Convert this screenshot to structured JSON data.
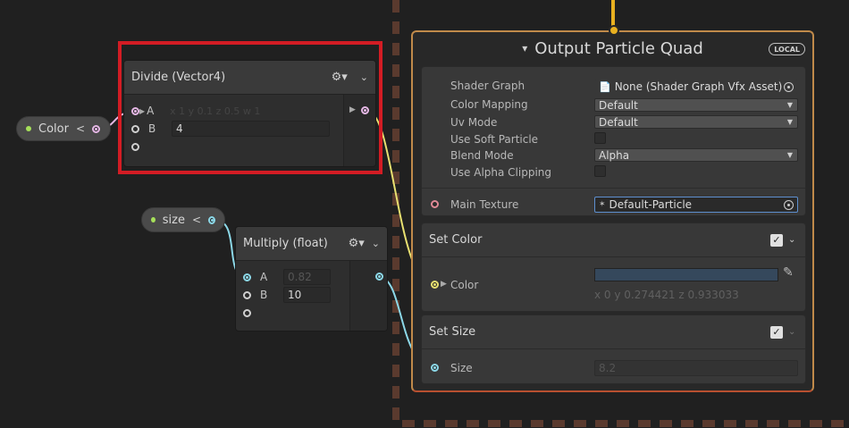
{
  "color_pill": {
    "label": "Color"
  },
  "size_pill": {
    "label": "size"
  },
  "divide_node": {
    "title": "Divide (Vector4)",
    "input_a_label": "A",
    "input_a_value": "x 1 y 0.1 z 0.5 w 1",
    "input_b_label": "B",
    "input_b_value": "4"
  },
  "multiply_node": {
    "title": "Multiply (float)",
    "input_a_label": "A",
    "input_a_value": "0.82",
    "input_b_label": "B",
    "input_b_value": "10"
  },
  "output_context": {
    "title": "Output Particle Quad",
    "badge": "LOCAL",
    "settings": {
      "shader_graph_label": "Shader Graph",
      "shader_graph_value": "None (Shader Graph Vfx Asset)",
      "color_mapping_label": "Color Mapping",
      "color_mapping_value": "Default",
      "uv_mode_label": "Uv Mode",
      "uv_mode_value": "Default",
      "soft_particle_label": "Use Soft Particle",
      "blend_mode_label": "Blend Mode",
      "blend_mode_value": "Alpha",
      "alpha_clipping_label": "Use Alpha Clipping"
    },
    "main_texture_label": "Main Texture",
    "main_texture_value": "Default-Particle"
  },
  "set_color_block": {
    "title": "Set Color",
    "color_label": "Color",
    "xyz_readout": "x 0     y 0.274421 z 0.933033"
  },
  "set_size_block": {
    "title": "Set Size",
    "size_label": "Size",
    "size_value": "8.2"
  },
  "colors": {
    "highlight": "#d31c24",
    "context_border": "#c08a4a",
    "flow_port": "#e8b020"
  }
}
